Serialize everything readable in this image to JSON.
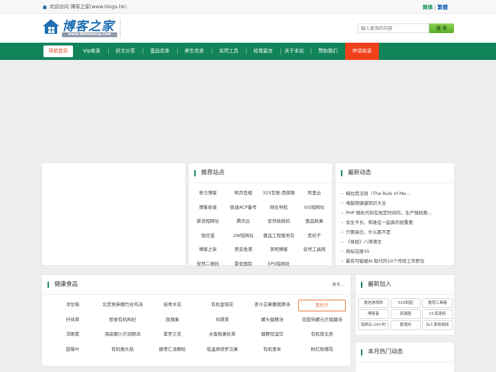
{
  "topbar": {
    "welcome": "欢迎访问 博客之家(www.blogs.hk)",
    "lang_simplified": "简体",
    "lang_separator": "|",
    "lang_traditional": "繁體"
  },
  "header": {
    "logo_title": "博客之家",
    "logo_url": "www.bkimming.com",
    "search_placeholder": "输入查询的内容",
    "search_button": "搜 索"
  },
  "nav": {
    "items": [
      "导航首页",
      "Vip收录",
      "好文分享",
      "壹品花茶",
      "养生花茶",
      "实然工具",
      "给我留言",
      "关于本站",
      "赞助我们",
      "申请收录"
    ]
  },
  "recommended": {
    "title": "推荐站点",
    "items": [
      "舍力博客",
      "明月登楼",
      "325互联-西部数",
      "阿里云",
      "博客收录",
      "极速ACP备考",
      "网址导航",
      "GG短网址",
      "新浪短网址",
      "腾讯云",
      "安然收款码",
      "壹品鲜果",
      "短信宝",
      "2W短网址",
      "壹品工程服务有",
      "黑杞子",
      "博客之家",
      "美安香港",
      "李明博客",
      "安然工具网",
      "安然二维码",
      "景安国际",
      "EPS短网址",
      ""
    ]
  },
  "latest_news": {
    "title": "最新动态",
    "items": [
      "梅拉宾法则（The Rule of Me...",
      "电脑快捷键知识大全",
      "PHP 随机代码在规定时间内，生产随机数...",
      "余生不长，和谁在一起真的很重要",
      "只要高位，什么都不是",
      "《易经》八律源文",
      "商标註册35",
      "最有可能被AI 取代的10个传统工作职位"
    ]
  },
  "healthy_food": {
    "title": "健康食品",
    "more": "更多...",
    "items": [
      "洋甘菊",
      "北芪党参撒竹丝鸡汤",
      "接骨木花",
      "有机金银花",
      "杏汁白果撒猪肺汤",
      "黑杞子",
      "纤体茶",
      "即食有机枸杞",
      "玫瑰果",
      "玛黛茶",
      "螺头健脾汤",
      "花胶响螺元贝猪腱汤",
      "活眼素",
      "海底椰川贝润肺汤",
      "紫罗兰花",
      "水蜜桃果粒茶",
      "健脾祛湿饮",
      "有机南北杏",
      "甜菊叶",
      "有机猴头菇",
      "酸枣仁汤颗粒",
      "低温烘焙罗汉果",
      "有机薏米",
      "粉红玫瑰花"
    ],
    "highlight_index": 5
  },
  "latest_added": {
    "title": "最新加入",
    "items": [
      "香信游戏网",
      "520刮因",
      "香塔工具箱",
      "博客巷",
      "资源圈",
      "CC资源网",
      "南顾云-24小时",
      "香塔网",
      "仙人掌视频网"
    ]
  },
  "monthly_hot": {
    "title": "本月热门动态"
  },
  "colors": {
    "nav_green": "#11845a",
    "apply_red": "#f1411b",
    "highlight_orange": "#e9733a"
  }
}
